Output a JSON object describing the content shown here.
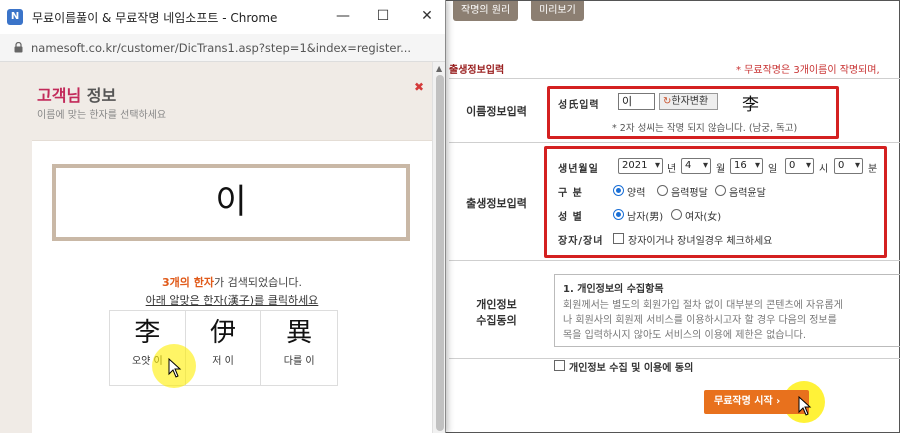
{
  "background": {
    "tabs": [
      "작명의 원리",
      "미리보기"
    ],
    "section_title": "출생정보입력",
    "notice": "* 무료작명은 3개이름이 작명되며,",
    "name_row": {
      "label": "이름정보입력",
      "surname_label": "성氏입력",
      "surname_value": "이",
      "convert_button": "한자변환",
      "hanja_result": "李",
      "note": "* 2자 성씨는 작명 되지 않습니다. (남궁, 독고)"
    },
    "birth_row": {
      "label": "출생정보입력",
      "date_label": "생년월일",
      "year": "2021",
      "year_unit": "년",
      "month": "4",
      "month_unit": "월",
      "day": "16",
      "day_unit": "일",
      "hour": "0",
      "hour_unit": "시",
      "minute": "0",
      "minute_unit": "분",
      "calendar_label": "구 분",
      "calendar_options": [
        "양력",
        "음력평달",
        "음력윤달"
      ],
      "gender_label": "성 별",
      "gender_options": [
        "남자(男)",
        "여자(女)"
      ],
      "eldest_label": "장자/장녀",
      "eldest_text": "장자이거나 장녀일경우 체크하세요"
    },
    "privacy": {
      "label_line1": "개인정보",
      "label_line2": "수집동의",
      "title": "1. 개인정보의 수집항목",
      "lines": [
        "회원께서는 별도의 회원가입 절차 없이 대부분의 콘텐츠에 자유롭게",
        "나 회원사의 회원제 서비스를 이용하시고자 할 경우 다음의 정보를",
        "목을 입력하시지 않아도 서비스의 이용에 제한은 없습니다."
      ],
      "agree_text": "개인정보 수집 및 이용에 동의"
    },
    "start_button": "무료작명 시작"
  },
  "popup": {
    "app_icon": "N",
    "window_title": "무료이름풀이 & 무료작명 네임소프트 - Chrome",
    "url": "namesoft.co.kr/customer/DicTrans1.asp?step=1&index=register...",
    "title_accent": "고객님",
    "title_rest": " 정보",
    "subtitle": "이름에 맞는 한자를 선택하세요",
    "input_char": "이",
    "found_count": "3개의 한자",
    "found_rest": "가 검색되었습니다.",
    "instruction": "아래 알맞은 한자(漢子)를 클릭하세요",
    "hanja": [
      {
        "char": "李",
        "reading": "오얏 이"
      },
      {
        "char": "伊",
        "reading": "저 이"
      },
      {
        "char": "異",
        "reading": "다를 이"
      }
    ]
  },
  "colors": {
    "accent_red": "#d42020",
    "title_pink": "#c22a5a",
    "orange": "#e8711d",
    "highlight_yellow": "#ffee00"
  }
}
